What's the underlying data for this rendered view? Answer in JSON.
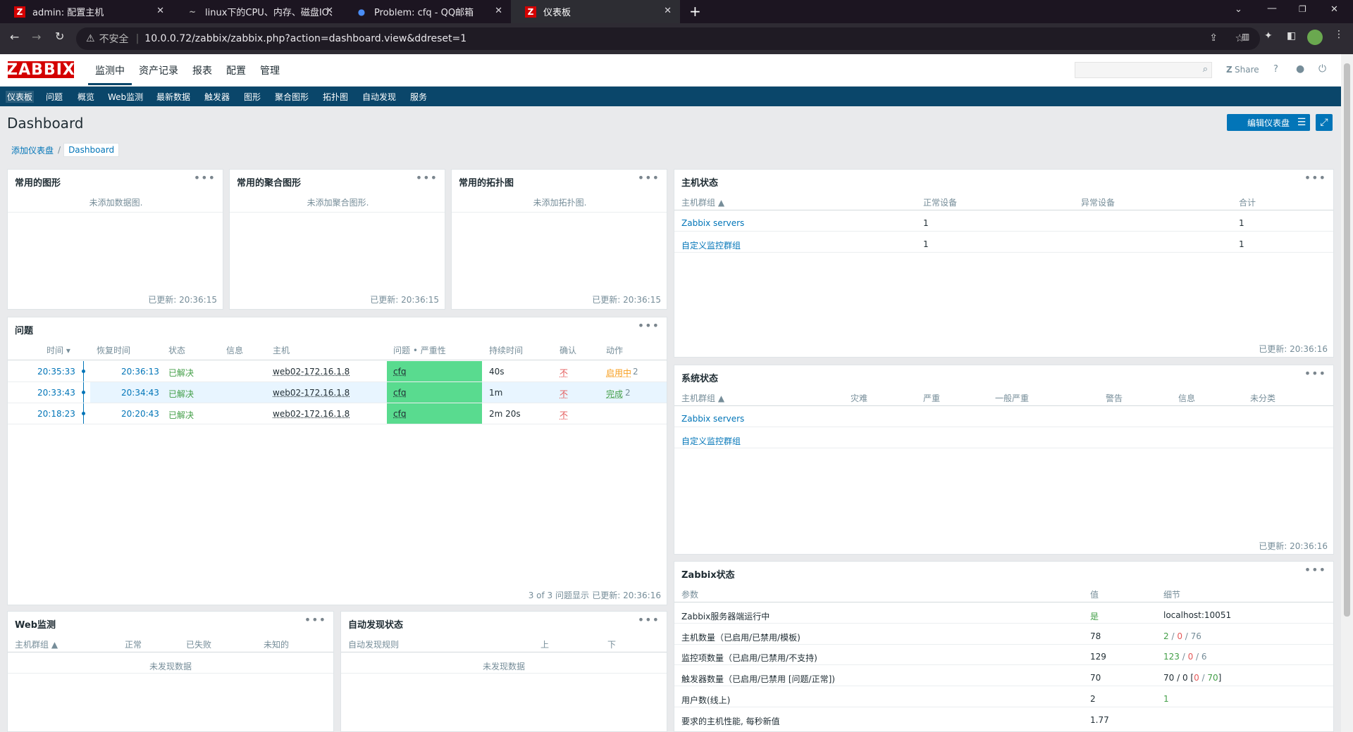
{
  "browser": {
    "tabs": [
      {
        "title": "admin: 配置主机",
        "icon": "Z"
      },
      {
        "title": "linux下的CPU、内存、磁盘IO、",
        "icon": "~"
      },
      {
        "title": "Problem: cfq - QQ邮箱",
        "icon": "●"
      },
      {
        "title": "仪表板",
        "icon": "Z"
      }
    ],
    "security": "不安全",
    "url": "10.0.0.72/zabbix/zabbix.php?action=dashboard.view&ddreset=1"
  },
  "header": {
    "logo": "ZABBIX",
    "menu": [
      "监测中",
      "资产记录",
      "报表",
      "配置",
      "管理"
    ],
    "share": "Share",
    "help": "?",
    "colors": {
      "brand": "#d40000",
      "nav": "#0a466a",
      "accent": "#0275b8"
    }
  },
  "submenu": [
    "仪表板",
    "问题",
    "概览",
    "Web监测",
    "最新数据",
    "触发器",
    "图形",
    "聚合图形",
    "拓扑图",
    "自动发现",
    "服务"
  ],
  "page": {
    "title": "Dashboard",
    "edit_button": "编辑仪表盘",
    "breadcrumb": [
      "添加仪表盘",
      "Dashboard"
    ]
  },
  "w_graphs": {
    "title": "常用的图形",
    "empty": "未添加数据图.",
    "updated": "已更新: 20:36:15"
  },
  "w_screens": {
    "title": "常用的聚合图形",
    "empty": "未添加聚合图形.",
    "updated": "已更新: 20:36:15"
  },
  "w_maps": {
    "title": "常用的拓扑图",
    "empty": "未添加拓扑图.",
    "updated": "已更新: 20:36:15"
  },
  "w_hosts": {
    "title": "主机状态",
    "headers": [
      "主机群组 ▲",
      "正常设备",
      "异常设备",
      "合计"
    ],
    "rows": [
      [
        "Zabbix servers",
        "1",
        "",
        "1"
      ],
      [
        "自定义监控群组",
        "1",
        "",
        "1"
      ]
    ],
    "updated": "已更新: 20:36:16"
  },
  "w_problems": {
    "title": "问题",
    "headers": [
      "时间 ▾",
      "恢复时间",
      "状态",
      "信息",
      "主机",
      "问题 • 严重性",
      "持续时间",
      "确认",
      "动作"
    ],
    "rows": [
      {
        "time": "20:35:33",
        "recovery": "20:36:13",
        "status": "已解决",
        "host": "web02-172.16.1.8",
        "problem": "cfq",
        "duration": "40s",
        "ack": "不",
        "action": "启用中",
        "count": "2"
      },
      {
        "time": "20:33:43",
        "recovery": "20:34:43",
        "status": "已解决",
        "host": "web02-172.16.1.8",
        "problem": "cfq",
        "duration": "1m",
        "ack": "不",
        "action": "完成",
        "count": "2"
      },
      {
        "time": "20:18:23",
        "recovery": "20:20:43",
        "status": "已解决",
        "host": "web02-172.16.1.8",
        "problem": "cfq",
        "duration": "2m 20s",
        "ack": "不",
        "action": "",
        "count": ""
      }
    ],
    "footer": "3 of 3 问题显示",
    "updated": "已更新: 20:36:16"
  },
  "w_system": {
    "title": "系统状态",
    "headers": [
      "主机群组 ▲",
      "灾难",
      "严重",
      "一般严重",
      "警告",
      "信息",
      "未分类"
    ],
    "rows": [
      "Zabbix servers",
      "自定义监控群组"
    ],
    "updated": "已更新: 20:36:16"
  },
  "w_web": {
    "title": "Web监测",
    "headers": [
      "主机群组 ▲",
      "正常",
      "已失败",
      "未知的"
    ],
    "empty": "未发现数据"
  },
  "w_discovery": {
    "title": "自动发现状态",
    "headers": [
      "自动发现规则",
      "上",
      "下"
    ],
    "empty": "未发现数据"
  },
  "w_zabbix": {
    "title": "Zabbix状态",
    "headers": [
      "参数",
      "值",
      "细节"
    ],
    "rows": [
      {
        "p": "Zabbix服务器端运行中",
        "v": "是",
        "d": "localhost:10051"
      },
      {
        "p": "主机数量（已启用/已禁用/模板)",
        "v": "78",
        "d1": "2",
        "d2": "0",
        "d3": "76"
      },
      {
        "p": "监控项数量（已启用/已禁用/不支持)",
        "v": "129",
        "d1": "123",
        "d2": "0",
        "d3": "6"
      },
      {
        "p": "触发器数量（已启用/已禁用 [问题/正常])",
        "v": "70",
        "d1": "70 / 0 [",
        "d2": "0",
        "d3": "70",
        "d4": "]"
      },
      {
        "p": "用户数(线上)",
        "v": "2",
        "d1": "1"
      },
      {
        "p": "要求的主机性能, 每秒新值",
        "v": "1.77"
      }
    ]
  }
}
